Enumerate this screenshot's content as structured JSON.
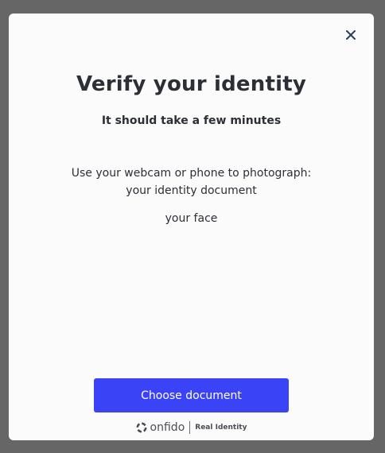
{
  "modal": {
    "close_icon": "close-icon",
    "title": "Verify your identity",
    "subtitle": "It should take a few minutes",
    "intro_line": "Use your webcam or phone to photograph:",
    "items": [
      "your identity document",
      "your face"
    ],
    "primary_button": "Choose document",
    "footer": {
      "logo_icon": "onfido-logo-icon",
      "brand": "onfido",
      "tagline": "Real Identity"
    }
  },
  "colors": {
    "backdrop": "#666666",
    "modal_bg": "#fbfbfc",
    "text": "#2c2f36",
    "primary": "#3a43f5",
    "close_icon": "#2c3e5c"
  }
}
